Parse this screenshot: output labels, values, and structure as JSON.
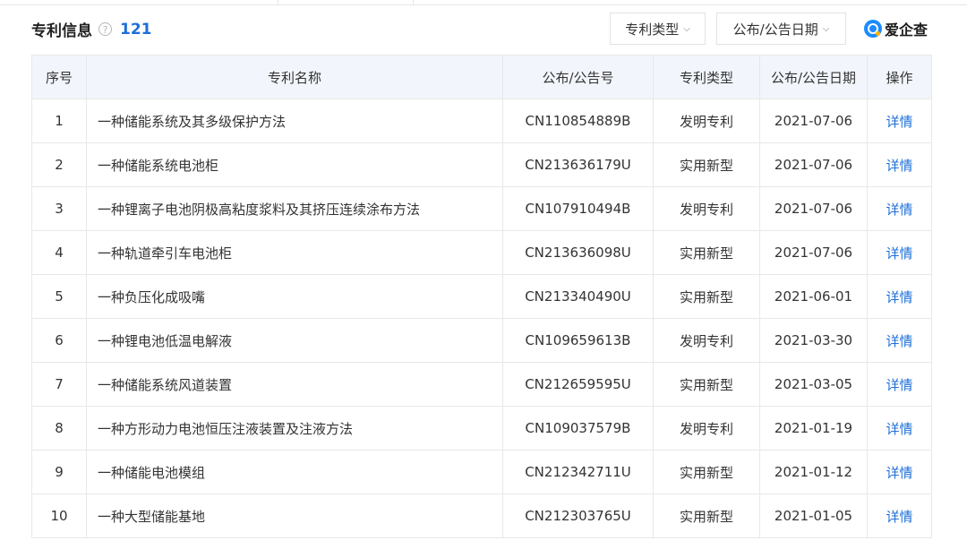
{
  "header": {
    "title": "专利信息",
    "help_icon": "?",
    "count": "121",
    "filter_type": "专利类型",
    "filter_date": "公布/公告日期",
    "chevron_icon": "chevron-down-icon",
    "brand": "爱企查"
  },
  "table": {
    "columns": [
      "序号",
      "专利名称",
      "公布/公告号",
      "专利类型",
      "公布/公告日期",
      "操作"
    ],
    "rows": [
      [
        "1",
        "一种储能系统及其多级保护方法",
        "CN110854889B",
        "发明专利",
        "2021-07-06",
        "详情"
      ],
      [
        "2",
        "一种储能系统电池柜",
        "CN213636179U",
        "实用新型",
        "2021-07-06",
        "详情"
      ],
      [
        "3",
        "一种锂离子电池阴极高粘度浆料及其挤压连续涂布方法",
        "CN107910494B",
        "发明专利",
        "2021-07-06",
        "详情"
      ],
      [
        "4",
        "一种轨道牵引车电池柜",
        "CN213636098U",
        "实用新型",
        "2021-07-06",
        "详情"
      ],
      [
        "5",
        "一种负压化成吸嘴",
        "CN213340490U",
        "实用新型",
        "2021-06-01",
        "详情"
      ],
      [
        "6",
        "一种锂电池低温电解液",
        "CN109659613B",
        "发明专利",
        "2021-03-30",
        "详情"
      ],
      [
        "7",
        "一种储能系统风道装置",
        "CN212659595U",
        "实用新型",
        "2021-03-05",
        "详情"
      ],
      [
        "8",
        "一种方形动力电池恒压注液装置及注液方法",
        "CN109037579B",
        "发明专利",
        "2021-01-19",
        "详情"
      ],
      [
        "9",
        "一种储能电池模组",
        "CN212342711U",
        "实用新型",
        "2021-01-12",
        "详情"
      ],
      [
        "10",
        "一种大型储能基地",
        "CN212303765U",
        "实用新型",
        "2021-01-05",
        "详情"
      ]
    ]
  },
  "colors": {
    "accent": "#1e6fd9",
    "header_bg": "#f2f6fc",
    "border": "#e8e8e8"
  }
}
